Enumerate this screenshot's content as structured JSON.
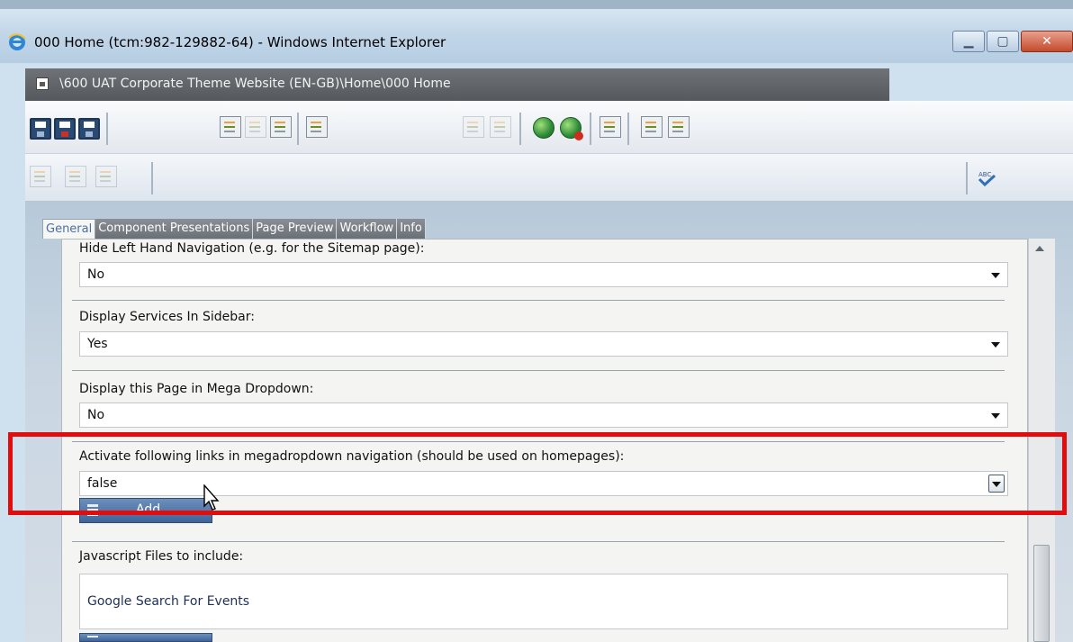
{
  "window": {
    "title": "000 Home (tcm:982-129882-64) - Windows Internet Explorer",
    "controls": [
      "minimize",
      "maximize",
      "close"
    ]
  },
  "header": {
    "path": "\\600 UAT Corporate Theme Website (EN-GB)\\Home\\000 Home"
  },
  "toolbar": {
    "row1_icons": [
      "save-icon",
      "save-and-close-icon",
      "save-and-new-icon",
      "check-in-icon",
      "check-out-icon",
      "undo-checkout-icon",
      "version-history-icon",
      "copy-icon",
      "paste-icon",
      "publish-icon",
      "unpublish-icon",
      "localize-icon",
      "preview-icon",
      "compare-icon"
    ],
    "row2_icons": [
      "cut-icon",
      "copy-icon",
      "paste-icon",
      "spellcheck-icon"
    ]
  },
  "tabs": [
    {
      "label": "General",
      "active": true
    },
    {
      "label": "Component Presentations",
      "active": false
    },
    {
      "label": "Page Preview",
      "active": false
    },
    {
      "label": "Workflow",
      "active": false
    },
    {
      "label": "Info",
      "active": false
    }
  ],
  "form": {
    "fields": [
      {
        "label": "Hide Left Hand Navigation (e.g. for the Sitemap page):",
        "value": "No"
      },
      {
        "label": "Display Services In Sidebar:",
        "value": "Yes"
      },
      {
        "label": "Display this Page in Mega Dropdown:",
        "value": "No"
      },
      {
        "label": "Activate following links in megadropdown navigation (should be used on homepages):",
        "value": "false",
        "highlighted": true
      },
      {
        "label": "Javascript Files to include:",
        "value": "Google Search For Events"
      }
    ],
    "add_button_label": "Add"
  },
  "colors": {
    "highlight": "#e30c0c",
    "header_bar": "#5f6367",
    "add_button": "#4a6fa5",
    "tab_active_text": "#4b6ea1"
  }
}
